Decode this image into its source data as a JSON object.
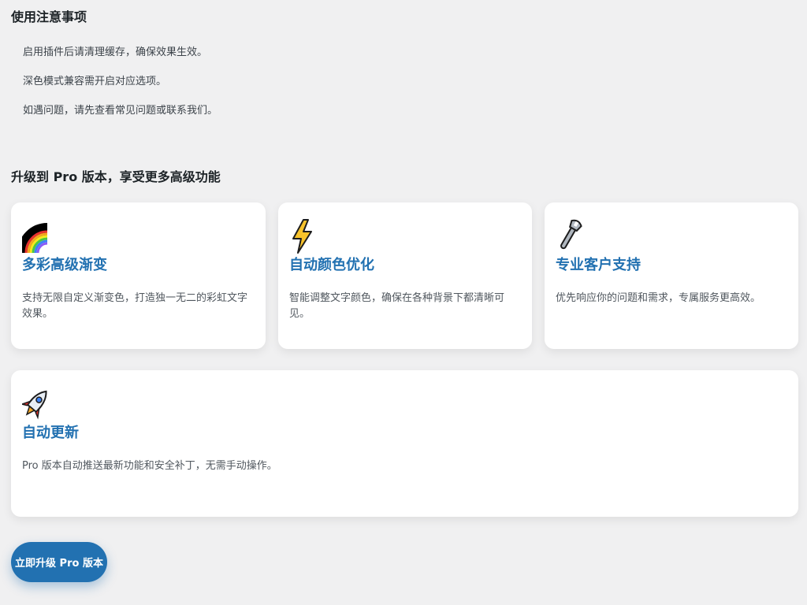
{
  "notice": {
    "title": "使用注意事项",
    "items": [
      "启用插件后请清理缓存，确保效果生效。",
      "深色模式兼容需开启对应选项。",
      "如遇问题，请先查看常见问题或联系我们。"
    ]
  },
  "upgrade": {
    "title": "升级到 Pro 版本，享受更多高级功能",
    "features": [
      {
        "icon": "rainbow-icon",
        "title": "多彩高级渐变",
        "desc": "支持无限自定义渐变色，打造独一无二的彩虹文字效果。"
      },
      {
        "icon": "lightning-icon",
        "title": "自动颜色优化",
        "desc": "智能调整文字颜色，确保在各种背景下都清晰可见。"
      },
      {
        "icon": "wrench-icon",
        "title": "专业客户支持",
        "desc": "优先响应你的问题和需求，专属服务更高效。"
      },
      {
        "icon": "rocket-icon",
        "title": "自动更新",
        "desc": "Pro 版本自动推送最新功能和安全补丁，无需手动操作。"
      }
    ],
    "button_label": "立即升级 Pro 版本"
  },
  "colors": {
    "accent": "#2271b1",
    "background": "#f0f0f1",
    "card": "#ffffff"
  }
}
